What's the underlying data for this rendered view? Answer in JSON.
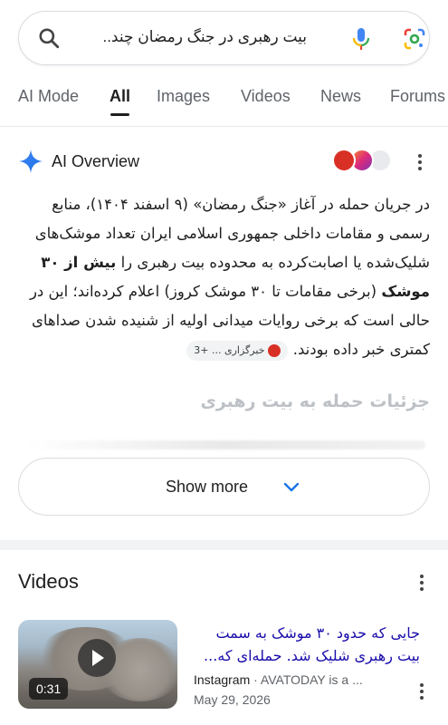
{
  "search": {
    "query": "بیت رهبری در جنگ رمضان چند..."
  },
  "tabs": [
    {
      "label": "AI Mode"
    },
    {
      "label": "All"
    },
    {
      "label": "Images"
    },
    {
      "label": "Videos"
    },
    {
      "label": "News"
    },
    {
      "label": "Forums"
    }
  ],
  "ai_overview": {
    "title": "AI Overview",
    "body_part1": "در جریان حمله در آغاز «جنگ رمضان» (۹ اسفند ۱۴۰۴)، منابع رسمی و مقامات داخلی جمهوری اسلامی ایران تعداد موشک‌های شلیک‌شده یا اصابت‌کرده به محدوده بیت رهبری را ",
    "body_bold": "بیش از ۳۰ موشک",
    "body_part2": " (برخی مقامات تا ۳۰ موشک کروز) اعلام کرده‌اند؛ این در حالی است که برخی روایات میدانی اولیه از شنیده شدن صداهای کمتری خبر داده بودند.",
    "chip_label": "خبرگزاری ...",
    "chip_count": "+3",
    "details_title": "جزئیات حمله به بیت رهبری",
    "show_more": "Show more"
  },
  "videos": {
    "title": "Videos",
    "items": [
      {
        "title": "جایی که حدود ۳۰ موشک به سمت بیت رهبری شلیک شد. حمله‌ای که...",
        "source": "Instagram",
        "channel": " · AVATODAY is a ...",
        "date": "May 29, 2026",
        "duration": "0:31"
      }
    ]
  },
  "colors": {
    "link_blue": "#1a0dab",
    "accent_google_blue": "#4285f4",
    "badge_red": "#d93025"
  }
}
